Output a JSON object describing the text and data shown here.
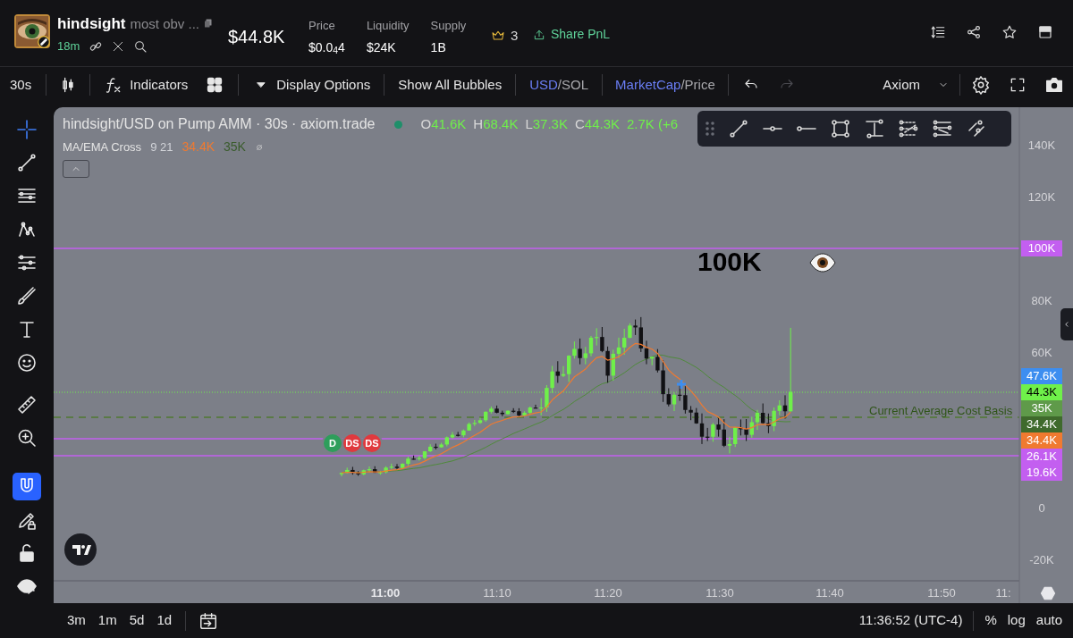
{
  "header": {
    "token_name": "hindsight",
    "token_description": "most obv ...",
    "age": "18m",
    "market_cap": "$44.8K",
    "stats": [
      {
        "label": "Price",
        "value": "$0.0$_{4}$4"
      },
      {
        "label": "Liquidity",
        "value": "$24K"
      },
      {
        "label": "Supply",
        "value": "1B"
      }
    ],
    "crown_count": "3",
    "share_button": "Share PnL"
  },
  "toolbar": {
    "interval": "30s",
    "indicators_button": "Indicators",
    "display_options_button": "Display Options",
    "bubbles_button": "Show All Bubbles",
    "currency_toggle": [
      {
        "label": "USD",
        "selected": true
      },
      {
        "label": "SOL",
        "selected": false
      }
    ],
    "currency_separator": "/",
    "value_toggle": [
      {
        "label": "MarketCap",
        "selected": true
      },
      {
        "label": "Price",
        "selected": false
      }
    ],
    "value_separator": "/",
    "redo_disabled": true,
    "theme_select": "Axiom"
  },
  "left_tools": [
    {
      "kind": "crosshair",
      "selected": true
    },
    {
      "kind": "trendline",
      "selected": false
    },
    {
      "kind": "hlines",
      "selected": false
    },
    {
      "kind": "pattern",
      "selected": false
    },
    {
      "kind": "fib",
      "selected": false
    },
    {
      "kind": "brush",
      "selected": false
    },
    {
      "kind": "text",
      "selected": false
    },
    {
      "kind": "smiley",
      "selected": false
    },
    {
      "kind": "ruler",
      "selected": false
    },
    {
      "kind": "zoom",
      "selected": false
    },
    {
      "kind": "magnet",
      "selected": true
    },
    {
      "kind": "pencillock",
      "selected": false
    },
    {
      "kind": "lock",
      "selected": false
    },
    {
      "kind": "eye",
      "selected": false
    }
  ],
  "chart": {
    "title": "hindsight/USD on Pump AMM · 30s · axiom.trade",
    "ohlc": [
      {
        "key": "O",
        "value": "41.6K"
      },
      {
        "key": "H",
        "value": "68.4K"
      },
      {
        "key": "L",
        "value": "37.3K"
      },
      {
        "key": "C",
        "value": "44.3K"
      }
    ],
    "change": "2.7K (+6",
    "indicator": {
      "name": "MA/EMA Cross",
      "params": "9 21",
      "values": [
        {
          "text": "34.4K",
          "color": "#f07a30"
        },
        {
          "text": "35K",
          "color": "#3a5c2c"
        }
      ]
    },
    "y_axis_labels": [
      "140K",
      "120K",
      "80K",
      "60K",
      "0",
      "-20K"
    ],
    "x_axis_labels": [
      {
        "label": "11:00",
        "bold": true
      },
      {
        "label": "11:10",
        "bold": false
      },
      {
        "label": "11:20",
        "bold": false
      },
      {
        "label": "11:30",
        "bold": false
      },
      {
        "label": "11:40",
        "bold": false
      },
      {
        "label": "11:50",
        "bold": false
      },
      {
        "label": "11:",
        "bold": false
      }
    ],
    "price_tags": [
      {
        "text": "47.6K",
        "color": "#3d8ef0",
        "dark_text": false
      },
      {
        "text": "44.3K",
        "color": "#6ff04a",
        "dark_text": true
      },
      {
        "text": "35K",
        "color": "#5f9a4a",
        "dark_text": false
      },
      {
        "text": "34.4K",
        "color": "#3f6a2c",
        "dark_text": false
      },
      {
        "text": "34.4K",
        "color": "#f07a30",
        "dark_text": false
      },
      {
        "text": "26.1K",
        "color": "#c35ff0",
        "dark_text": false
      },
      {
        "text": "19.6K",
        "color": "#c35ff0",
        "dark_text": false
      }
    ],
    "side_tag": "100K",
    "cost_basis_label": "Current Average Cost Basis",
    "annotation": "100K",
    "bubbles": [
      {
        "label": "D",
        "color": "#2e9e5b"
      },
      {
        "label": "DS",
        "color": "#e0393e"
      },
      {
        "label": "DS",
        "color": "#e0393e"
      }
    ]
  },
  "bottom_bar": {
    "ranges": [
      "3m",
      "1m",
      "5d",
      "1d"
    ],
    "clock": "11:36:52 (UTC-4)",
    "options": [
      "%",
      "log",
      "auto"
    ]
  }
}
